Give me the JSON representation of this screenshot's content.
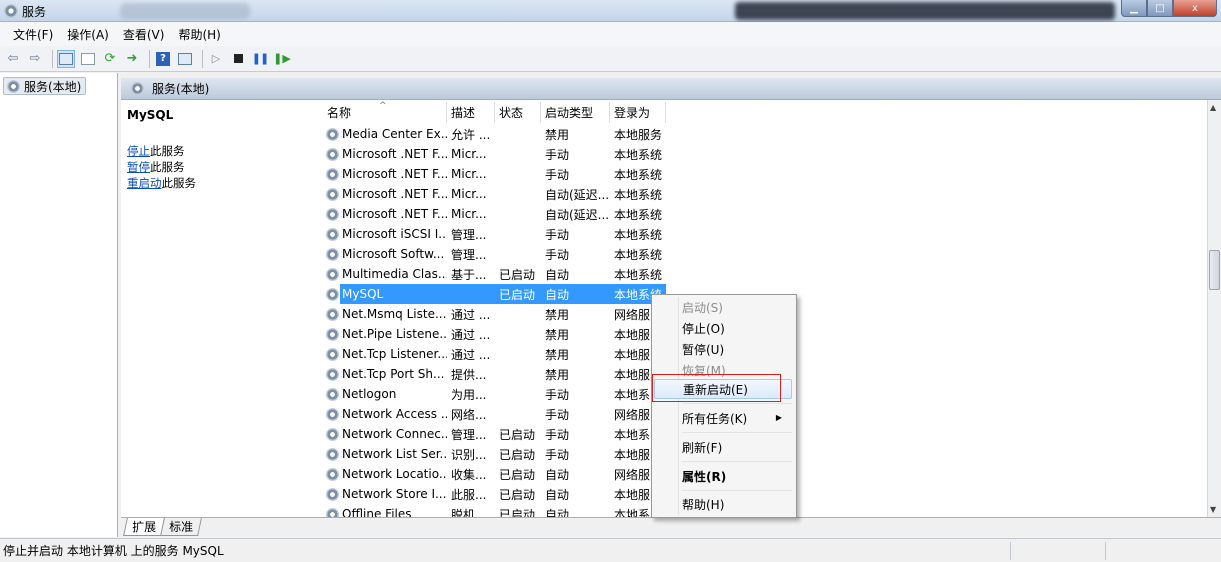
{
  "window": {
    "title": "服务",
    "close_glyph": "x"
  },
  "menu": [
    "文件(F)",
    "操作(A)",
    "查看(V)",
    "帮助(H)"
  ],
  "toolbar": {
    "icons": [
      "back-arrow-icon",
      "forward-arrow-icon",
      "console-tree-icon",
      "properties-pane-icon",
      "refresh-icon",
      "export-list-icon",
      "help-icon",
      "show-hide-icon",
      "start-service-icon",
      "stop-service-icon",
      "pause-service-icon",
      "resume-service-icon"
    ]
  },
  "tree": {
    "root": "服务(本地)"
  },
  "panel": {
    "header": "服务(本地)"
  },
  "details": {
    "service_name": "MySQL",
    "stop_link": "停止",
    "stop_suffix": "此服务",
    "pause_link": "暂停",
    "pause_suffix": "此服务",
    "restart_link": "重启动",
    "restart_suffix": "此服务"
  },
  "columns": [
    "名称",
    "描述",
    "状态",
    "启动类型",
    "登录为"
  ],
  "rows": [
    {
      "name": "Media Center Ex...",
      "desc": "允许 ...",
      "status": "",
      "start": "禁用",
      "logon": "本地服务"
    },
    {
      "name": "Microsoft .NET F...",
      "desc": "Micr...",
      "status": "",
      "start": "手动",
      "logon": "本地系统"
    },
    {
      "name": "Microsoft .NET F...",
      "desc": "Micr...",
      "status": "",
      "start": "手动",
      "logon": "本地系统"
    },
    {
      "name": "Microsoft .NET F...",
      "desc": "Micr...",
      "status": "",
      "start": "自动(延迟...",
      "logon": "本地系统"
    },
    {
      "name": "Microsoft .NET F...",
      "desc": "Micr...",
      "status": "",
      "start": "自动(延迟...",
      "logon": "本地系统"
    },
    {
      "name": "Microsoft iSCSI I...",
      "desc": "管理...",
      "status": "",
      "start": "手动",
      "logon": "本地系统"
    },
    {
      "name": "Microsoft Softw...",
      "desc": "管理...",
      "status": "",
      "start": "手动",
      "logon": "本地系统"
    },
    {
      "name": "Multimedia Clas...",
      "desc": "基于...",
      "status": "已启动",
      "start": "自动",
      "logon": "本地系统"
    },
    {
      "name": "MySQL",
      "desc": "",
      "status": "已启动",
      "start": "自动",
      "logon": "本地系统",
      "selected": true
    },
    {
      "name": "Net.Msmq Liste...",
      "desc": "通过 ...",
      "status": "",
      "start": "禁用",
      "logon": "网络服"
    },
    {
      "name": "Net.Pipe Listene...",
      "desc": "通过 ...",
      "status": "",
      "start": "禁用",
      "logon": "本地服"
    },
    {
      "name": "Net.Tcp Listener...",
      "desc": "通过 ...",
      "status": "",
      "start": "禁用",
      "logon": "本地服"
    },
    {
      "name": "Net.Tcp Port Sh...",
      "desc": "提供...",
      "status": "",
      "start": "禁用",
      "logon": "本地服"
    },
    {
      "name": "Netlogon",
      "desc": "为用...",
      "status": "",
      "start": "手动",
      "logon": "本地系"
    },
    {
      "name": "Network Access ...",
      "desc": "网络...",
      "status": "",
      "start": "手动",
      "logon": "网络服"
    },
    {
      "name": "Network Connec...",
      "desc": "管理...",
      "status": "已启动",
      "start": "手动",
      "logon": "本地系"
    },
    {
      "name": "Network List Ser...",
      "desc": "识别...",
      "status": "已启动",
      "start": "手动",
      "logon": "本地服"
    },
    {
      "name": "Network Locatio...",
      "desc": "收集...",
      "status": "已启动",
      "start": "自动",
      "logon": "网络服"
    },
    {
      "name": "Network Store I...",
      "desc": "此服...",
      "status": "已启动",
      "start": "自动",
      "logon": "本地服"
    },
    {
      "name": "Offline Files",
      "desc": "脱机...",
      "status": "已启动",
      "start": "自动",
      "logon": "本地系"
    }
  ],
  "context_menu": {
    "start": "启动(S)",
    "stop": "停止(O)",
    "pause": "暂停(U)",
    "resume": "恢复(M)",
    "restart": "重新启动(E)",
    "all_tasks": "所有任务(K)",
    "refresh": "刷新(F)",
    "properties": "属性(R)",
    "help": "帮助(H)"
  },
  "tabs": [
    "扩展",
    "标准"
  ],
  "status_bar": {
    "text": "停止并启动 本地计算机 上的服务 MySQL"
  },
  "colors": {
    "selection": "#3399ff",
    "link": "#0b4fb5",
    "highlight_box": "#e01b1b"
  }
}
